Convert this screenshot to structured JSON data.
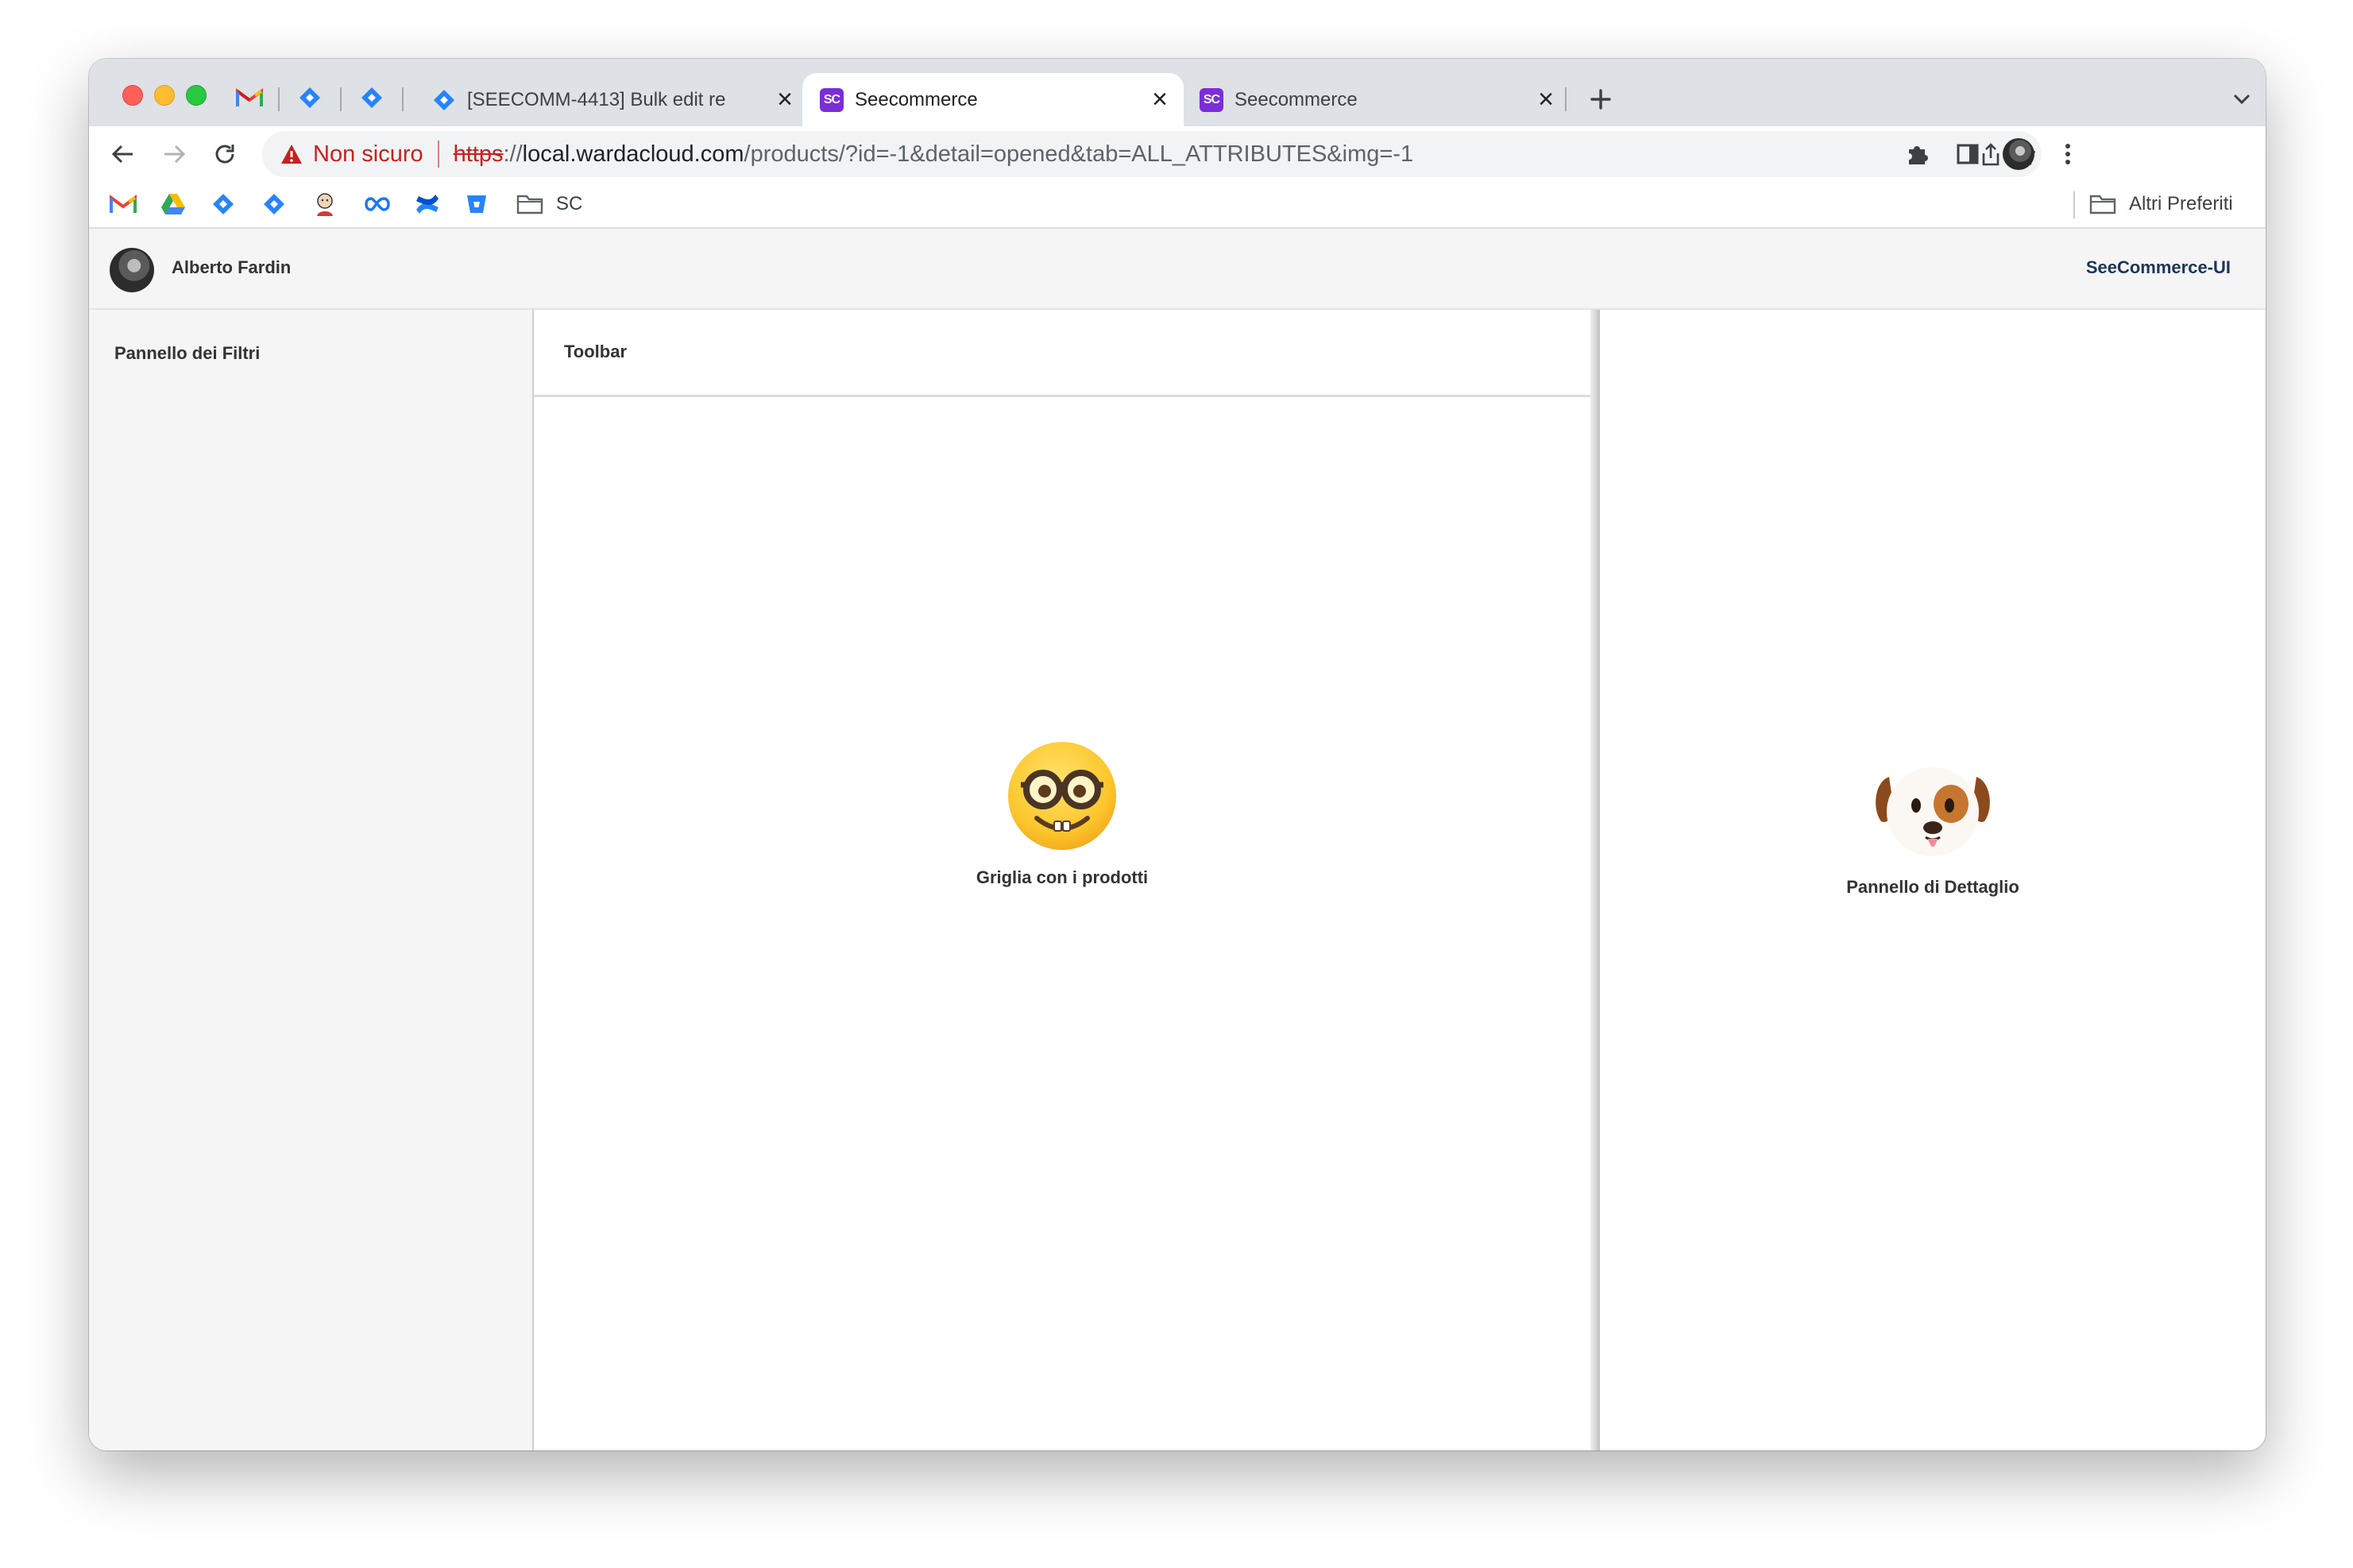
{
  "browser": {
    "tabs": [
      {
        "title": "[SEECOMM-4413] Bulk edit re",
        "active": false
      },
      {
        "title": "Seecommerce",
        "active": true,
        "favicon": "SC"
      },
      {
        "title": "Seecommerce",
        "active": false,
        "favicon": "SC"
      }
    ],
    "omnibox": {
      "security_label": "Non sicuro",
      "url_scheme": "https",
      "url_scheme_sep": "://",
      "url_host": "local.wardacloud.com",
      "url_path": "/products/?id=-1&detail=opened&tab=ALL_ATTRIBUTES&img=-1"
    },
    "bookmarks": {
      "folder_label": "SC",
      "other_bookmarks": "Altri Preferiti"
    }
  },
  "app": {
    "user_name": "Alberto Fardin",
    "brand": "SeeCommerce-UI",
    "filters_panel_title": "Pannello dei Filtri",
    "toolbar_title": "Toolbar",
    "grid_placeholder": {
      "emoji": "🤓",
      "label": "Griglia con i prodotti"
    },
    "detail_placeholder": {
      "emoji": "🐶",
      "label": "Pannello di Dettaglio"
    }
  },
  "colors": {
    "tabstrip_bg": "#dee1e6",
    "insecure_red": "#c5221f",
    "brand_text": "#1c3557",
    "sc_favicon": "#7b2dd8"
  }
}
